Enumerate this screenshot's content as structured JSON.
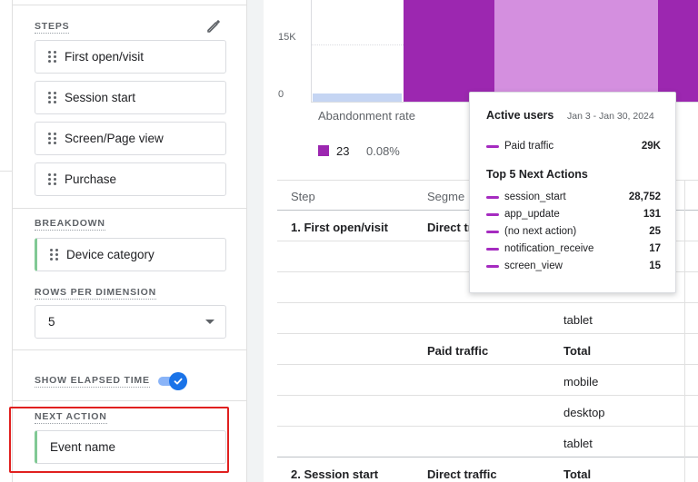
{
  "settings": {
    "steps": {
      "title": "STEPS",
      "items": [
        "First open/visit",
        "Session start",
        "Screen/Page view",
        "Purchase"
      ]
    },
    "breakdown": {
      "title": "BREAKDOWN",
      "value": "Device category"
    },
    "rows_per_dimension": {
      "title": "ROWS PER DIMENSION",
      "value": "5"
    },
    "elapsed_time": {
      "title": "SHOW ELAPSED TIME",
      "enabled": true
    },
    "next_action": {
      "title": "NEXT ACTION",
      "value": "Event name"
    }
  },
  "chart": {
    "ytick_15k": "15K",
    "ytick_0": "0",
    "abandonment_label": "Abandonment rate",
    "abandon_count": "23",
    "abandon_pct": "0.08%",
    "colors": {
      "purple": "#9c27b0",
      "light_purple": "#d48fdf",
      "blue_bar": "#c5d5f3"
    }
  },
  "tooltip": {
    "active_users_label": "Active users",
    "date_range": "Jan 3 - Jan 30, 2024",
    "segment": {
      "label": "Paid traffic",
      "value": "29K"
    },
    "next_actions_title": "Top 5 Next Actions",
    "actions": [
      {
        "label": "session_start",
        "value": "28,752"
      },
      {
        "label": "app_update",
        "value": "131"
      },
      {
        "label": "(no next action)",
        "value": "25"
      },
      {
        "label": "notification_receive",
        "value": "17"
      },
      {
        "label": "screen_view",
        "value": "15"
      }
    ]
  },
  "table": {
    "headers": {
      "step": "Step",
      "segment": "Segme"
    },
    "rows": {
      "step1": "1. First open/visit",
      "direct1": "Direct tr",
      "tablet1": "tablet",
      "paid": "Paid traffic",
      "total_paid": "Total",
      "mobile": "mobile",
      "desktop": "desktop",
      "tablet2": "tablet",
      "step2": "2. Session start",
      "direct2": "Direct traffic",
      "total2": "Total"
    }
  }
}
